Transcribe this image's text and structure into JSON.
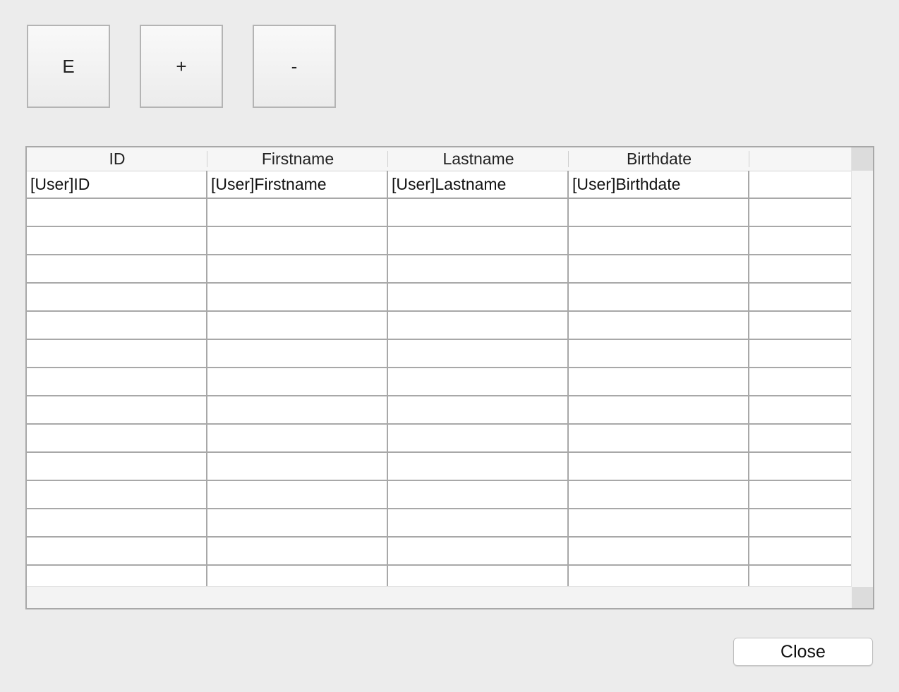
{
  "toolbar": {
    "edit_label": "E",
    "add_label": "+",
    "remove_label": "-"
  },
  "table": {
    "columns": [
      "ID",
      "Firstname",
      "Lastname",
      "Birthdate"
    ],
    "rows": [
      [
        "[User]ID",
        "[User]Firstname",
        "[User]Lastname",
        "[User]Birthdate"
      ],
      [
        "",
        "",
        "",
        ""
      ],
      [
        "",
        "",
        "",
        ""
      ],
      [
        "",
        "",
        "",
        ""
      ],
      [
        "",
        "",
        "",
        ""
      ],
      [
        "",
        "",
        "",
        ""
      ],
      [
        "",
        "",
        "",
        ""
      ],
      [
        "",
        "",
        "",
        ""
      ],
      [
        "",
        "",
        "",
        ""
      ],
      [
        "",
        "",
        "",
        ""
      ],
      [
        "",
        "",
        "",
        ""
      ],
      [
        "",
        "",
        "",
        ""
      ],
      [
        "",
        "",
        "",
        ""
      ],
      [
        "",
        "",
        "",
        ""
      ],
      [
        "",
        "",
        "",
        ""
      ]
    ]
  },
  "footer": {
    "close_label": "Close"
  }
}
